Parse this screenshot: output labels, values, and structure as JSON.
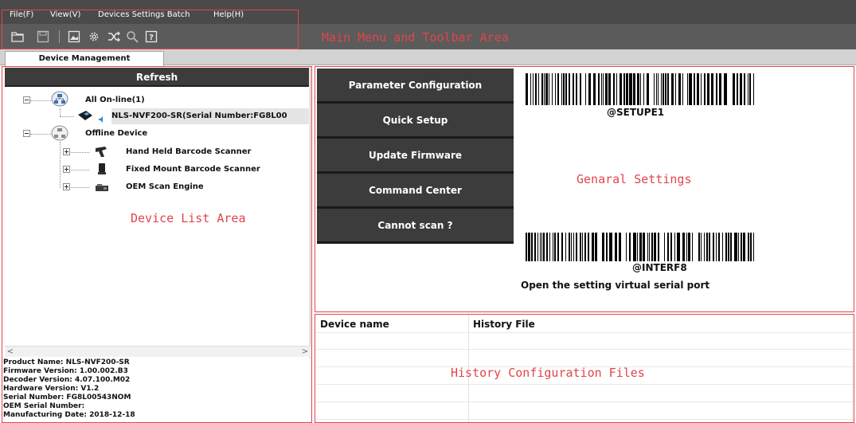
{
  "menu": [
    "File(F)",
    "View(V)",
    "Devices Settings Batch",
    "Help(H)"
  ],
  "toolbar_icons": [
    "folder-open-icon",
    "save-icon",
    "image-icon",
    "gear-icon",
    "shuffle-icon",
    "magnify-icon",
    "help-icon"
  ],
  "tab": {
    "label": "Device Management"
  },
  "refresh_label": "Refresh",
  "tree": {
    "online_group": "All On-line(1)",
    "online_device": "NLS-NVF200-SR(Serial Number:FG8L00",
    "offline_group": "Offline Device",
    "offline_items": [
      "Hand Held Barcode Scanner",
      "Fixed Mount Barcode Scanner",
      "OEM Scan Engine"
    ]
  },
  "device_info": [
    "Product Name: NLS-NVF200-SR",
    "Firmware Version: 1.00.002.B3",
    "Decoder Version: 4.07.100.M02",
    "Hardware Version: V1.2",
    "Serial Number: FG8L00543NOM",
    "OEM Serial Number:",
    "Manufacturing Date: 2018-12-18"
  ],
  "actions": [
    "Parameter Configuration",
    "Quick Setup",
    "Update Firmware",
    "Command Center",
    "Cannot scan ?"
  ],
  "barcodes": {
    "top_caption": "@SETUPE1",
    "bottom_caption": "@INTERF8",
    "note": "Open the setting virtual serial port"
  },
  "history": {
    "col_device": "Device name",
    "col_file": "History File"
  },
  "annotations": {
    "menu_toolbar": "Main Menu and Toolbar Area",
    "device_list": "Device List Area",
    "general_settings": "Genaral Settings",
    "history_files": "History Configuration Files"
  },
  "colors": {
    "annotation": "#e0454a",
    "dark_button": "#3c3c3c",
    "menubar": "#4a4a4a",
    "toolbar": "#5b5b5b"
  }
}
